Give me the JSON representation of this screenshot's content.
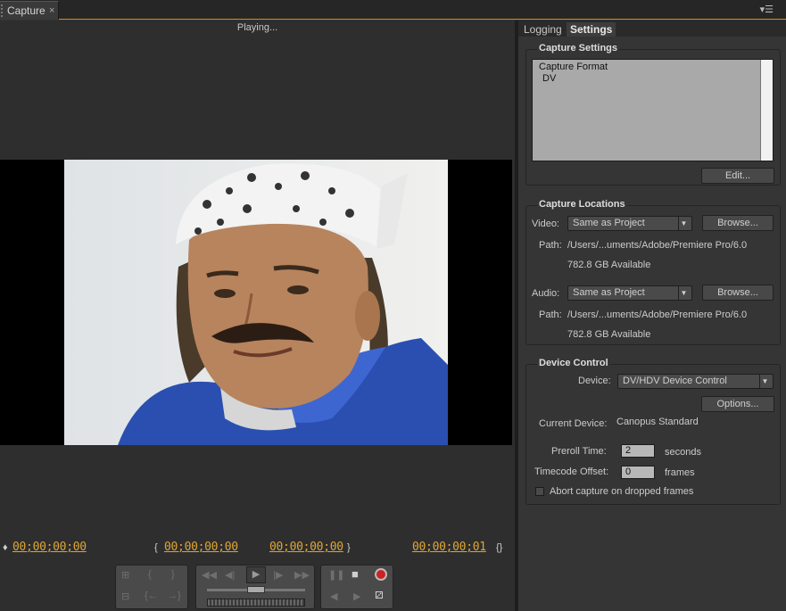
{
  "window": {
    "tab_label": "Capture",
    "close_glyph": "×",
    "panel_menu_glyph": "▾☰"
  },
  "monitor": {
    "status": "Playing...",
    "timecodes": {
      "current": "00;00;00;00",
      "in_point": "00;00;00;00",
      "out_point": "00;00;00;00",
      "duration": "00;00;00;01"
    }
  },
  "transport": {
    "set_in": "{",
    "set_out": "}",
    "goto_in": "{←",
    "goto_out": "→}",
    "rewind": "◀◀",
    "step_back": "◀|",
    "play": "▶",
    "step_fwd": "|▶",
    "fast_fwd": "▶▶",
    "pause": "❚❚",
    "stop": "■",
    "slow_rev": "◀",
    "slow_play": "▶"
  },
  "right_tabs": [
    {
      "label": "Logging",
      "active": false
    },
    {
      "label": "Settings",
      "active": true
    }
  ],
  "capture_settings": {
    "title": "Capture Settings",
    "list_lines": [
      "Capture Format",
      " DV"
    ],
    "edit_button": "Edit..."
  },
  "capture_locations": {
    "title": "Capture Locations",
    "video_label": "Video:",
    "video_select": "Same as Project",
    "video_browse": "Browse...",
    "video_path_label": "Path:",
    "video_path": "/Users/...uments/Adobe/Premiere Pro/6.0",
    "video_available": "782.8 GB Available",
    "audio_label": "Audio:",
    "audio_select": "Same as Project",
    "audio_browse": "Browse...",
    "audio_path_label": "Path:",
    "audio_path": "/Users/...uments/Adobe/Premiere Pro/6.0",
    "audio_available": "782.8 GB Available"
  },
  "device_control": {
    "title": "Device Control",
    "device_label": "Device:",
    "device_select": "DV/HDV Device Control",
    "options_button": "Options...",
    "current_device_label": "Current Device:",
    "current_device": "Canopus Standard",
    "preroll_label": "Preroll Time:",
    "preroll_value": "2",
    "preroll_unit": "seconds",
    "offset_label": "Timecode Offset:",
    "offset_value": "0",
    "offset_unit": "frames",
    "abort_label": "Abort capture on dropped frames",
    "abort_checked": false
  },
  "colors": {
    "timecode": "#e0a632",
    "accent_line": "#d28b1d",
    "record": "#cc2222"
  }
}
